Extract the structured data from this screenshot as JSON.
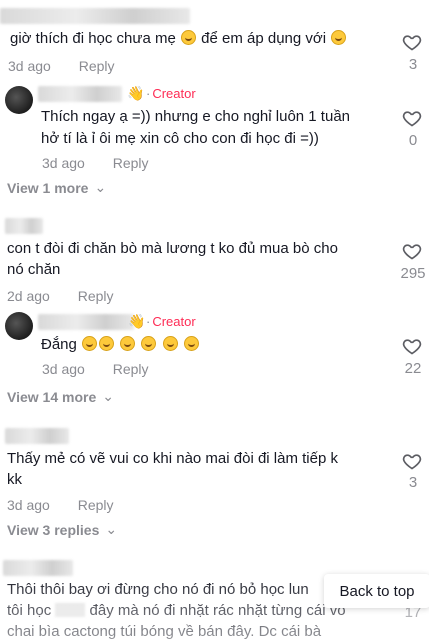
{
  "comments": [
    {
      "text": "giờ thích đi học chưa mẹ",
      "text_tail": "để em áp dụng với",
      "time": "3d ago",
      "reply": "Reply",
      "likes": "3"
    },
    {
      "creator": "Creator",
      "text_line1": "Thích ngay ạ =)) nhưng e cho nghỉ luôn 1 tuần",
      "text_line2": "hở tí là ỉ ôi mẹ xin cô cho con đi học đi =))",
      "time": "3d ago",
      "reply": "Reply",
      "likes": "0"
    },
    {
      "view_more": "View 1 more"
    },
    {
      "text_line1": "con t đòi đi chăn bò mà lương t ko đủ mua bò cho",
      "text_line2": "nó chăn",
      "time": "2d ago",
      "reply": "Reply",
      "likes": "295"
    },
    {
      "creator": "Creator",
      "text": "Đắng",
      "time": "3d ago",
      "reply": "Reply",
      "likes": "22"
    },
    {
      "view_more": "View 14 more"
    },
    {
      "text_line1": "Thấy mẻ có vẽ vui co khi nào mai đòi đi làm tiếp k",
      "text_line2": "kk",
      "time": "3d ago",
      "reply": "Reply",
      "likes": "3"
    },
    {
      "view_more": "View 3 replies"
    },
    {
      "text_line1": "Thôi thôi bay ơi đừng cho nó đi nó bỏ học lun",
      "text_line2_a": "tôi học",
      "text_line2_b": "đây mà nó đi nhặt rác nhặt từng cái vo",
      "text_line3": "chai bìa cactong túi bóng về bán đây. Dc cái bà",
      "likes": "17"
    }
  ],
  "back_to_top": "Back to top",
  "icons": {
    "like": "heart-outline-icon",
    "chevron": "chevron-down-icon",
    "creator_badge": "waving-hand-icon",
    "emoji": "grinning-face-icon"
  },
  "colors": {
    "creator": "#fe2c55",
    "muted": "#8a8b91",
    "text": "#161823"
  }
}
